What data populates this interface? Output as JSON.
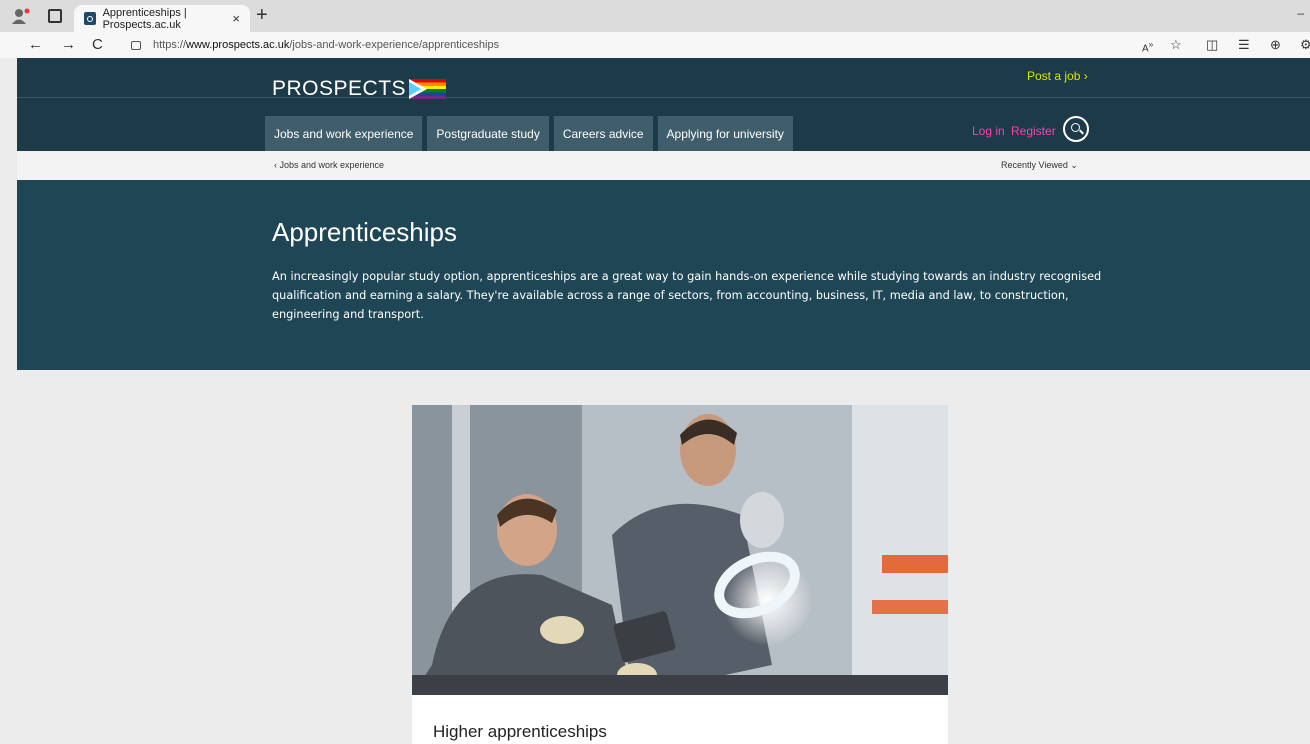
{
  "browser": {
    "tab_title": "Apprenticeships | Prospects.ac.uk",
    "tab_close": "×",
    "new_tab": "+",
    "url_prefix": "https://",
    "url_domain": "www.prospects.ac.uk",
    "url_path": "/jobs-and-work-experience/apprenticeships",
    "back": "←",
    "forward": "→",
    "reload": "C",
    "minimize": "–"
  },
  "header": {
    "logo_text": "PROSPECTS",
    "post_job": "Post a job ›",
    "nav": [
      "Jobs and work experience",
      "Postgraduate study",
      "Careers advice",
      "Applying for university"
    ],
    "login": "Log in",
    "register": "Register"
  },
  "breadcrumb": {
    "back_label": "‹  Jobs and work experience",
    "recently_viewed": "Recently Viewed   ⌄"
  },
  "hero": {
    "title": "Apprenticeships",
    "description": "An increasingly popular study option, apprenticeships are a great way to gain hands-on experience while studying towards an industry recognised qualification and earning a salary. They're available across a range of sectors, from accounting, business, IT, media and law, to construction, engineering and transport."
  },
  "card": {
    "title": "Higher apprenticeships"
  },
  "colors": {
    "header_bg": "#1d3a48",
    "hero_bg": "#1f4655",
    "accent_pink": "#ff3fae",
    "accent_yellow": "#d8e800"
  }
}
